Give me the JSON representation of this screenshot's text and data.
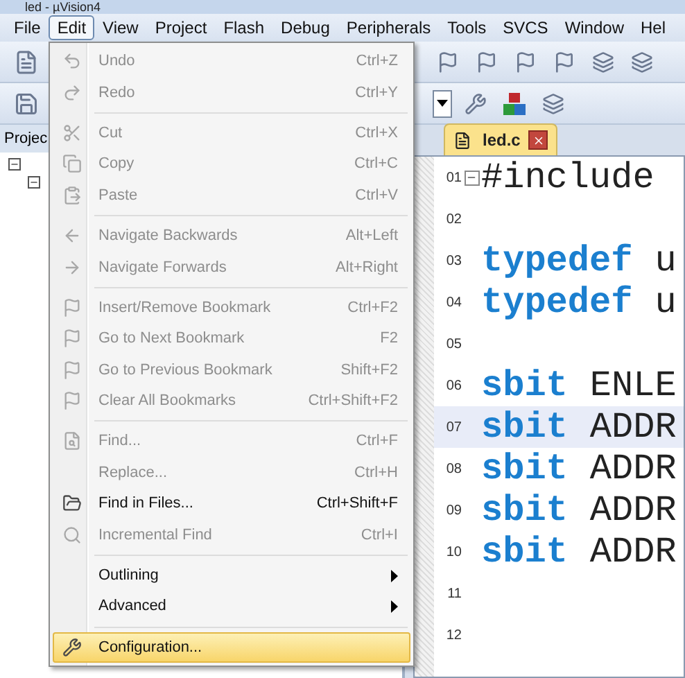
{
  "window": {
    "title": "led - µVision4"
  },
  "menubar": [
    {
      "label": "File",
      "selected": false
    },
    {
      "label": "Edit",
      "selected": true
    },
    {
      "label": "View",
      "selected": false
    },
    {
      "label": "Project",
      "selected": false
    },
    {
      "label": "Flash",
      "selected": false
    },
    {
      "label": "Debug",
      "selected": false
    },
    {
      "label": "Peripherals",
      "selected": false
    },
    {
      "label": "Tools",
      "selected": false
    },
    {
      "label": "SVCS",
      "selected": false
    },
    {
      "label": "Window",
      "selected": false
    },
    {
      "label": "Hel",
      "selected": false
    }
  ],
  "edit_menu": [
    {
      "kind": "item",
      "label": "Undo",
      "shortcut": "Ctrl+Z",
      "disabled": true,
      "selected": false
    },
    {
      "kind": "item",
      "label": "Redo",
      "shortcut": "Ctrl+Y",
      "disabled": true,
      "selected": false
    },
    {
      "kind": "separator"
    },
    {
      "kind": "item",
      "label": "Cut",
      "shortcut": "Ctrl+X",
      "disabled": true,
      "selected": false
    },
    {
      "kind": "item",
      "label": "Copy",
      "shortcut": "Ctrl+C",
      "disabled": true,
      "selected": false
    },
    {
      "kind": "item",
      "label": "Paste",
      "shortcut": "Ctrl+V",
      "disabled": true,
      "selected": false
    },
    {
      "kind": "separator"
    },
    {
      "kind": "item",
      "label": "Navigate Backwards",
      "shortcut": "Alt+Left",
      "disabled": true,
      "selected": false
    },
    {
      "kind": "item",
      "label": "Navigate Forwards",
      "shortcut": "Alt+Right",
      "disabled": true,
      "selected": false
    },
    {
      "kind": "separator"
    },
    {
      "kind": "item",
      "label": "Insert/Remove Bookmark",
      "shortcut": "Ctrl+F2",
      "disabled": true,
      "selected": false
    },
    {
      "kind": "item",
      "label": "Go to Next Bookmark",
      "shortcut": "F2",
      "disabled": true,
      "selected": false
    },
    {
      "kind": "item",
      "label": "Go to Previous Bookmark",
      "shortcut": "Shift+F2",
      "disabled": true,
      "selected": false
    },
    {
      "kind": "item",
      "label": "Clear All Bookmarks",
      "shortcut": "Ctrl+Shift+F2",
      "disabled": true,
      "selected": false
    },
    {
      "kind": "separator"
    },
    {
      "kind": "item",
      "label": "Find...",
      "shortcut": "Ctrl+F",
      "disabled": true,
      "selected": false
    },
    {
      "kind": "item",
      "label": "Replace...",
      "shortcut": "Ctrl+H",
      "disabled": true,
      "selected": false
    },
    {
      "kind": "item",
      "label": "Find in Files...",
      "shortcut": "Ctrl+Shift+F",
      "disabled": false,
      "selected": false
    },
    {
      "kind": "item",
      "label": "Incremental Find",
      "shortcut": "Ctrl+I",
      "disabled": true,
      "selected": false
    },
    {
      "kind": "separator"
    },
    {
      "kind": "submenu",
      "label": "Outlining",
      "disabled": false,
      "selected": false
    },
    {
      "kind": "submenu",
      "label": "Advanced",
      "disabled": false,
      "selected": false
    },
    {
      "kind": "separator"
    },
    {
      "kind": "item",
      "label": "Configuration...",
      "disabled": false,
      "selected": true
    }
  ],
  "project_panel": {
    "title": "Projec"
  },
  "editor": {
    "tab": {
      "label": "led.c"
    },
    "lines": [
      {
        "number": "01",
        "code": "#include",
        "foldable": true,
        "current": false
      },
      {
        "number": "02",
        "foldable": false,
        "current": false
      },
      {
        "number": "03",
        "keyword": "typedef",
        "code": "u",
        "foldable": false,
        "current": false
      },
      {
        "number": "04",
        "keyword": "typedef",
        "code": "u",
        "foldable": false,
        "current": false
      },
      {
        "number": "05",
        "foldable": false,
        "current": false
      },
      {
        "number": "06",
        "keyword": "sbit",
        "code": "ENLE",
        "foldable": false,
        "current": false
      },
      {
        "number": "07",
        "keyword": "sbit",
        "code": "ADDR",
        "foldable": false,
        "current": true
      },
      {
        "number": "08",
        "keyword": "sbit",
        "code": "ADDR",
        "foldable": false,
        "current": false
      },
      {
        "number": "09",
        "keyword": "sbit",
        "code": "ADDR",
        "foldable": false,
        "current": false
      },
      {
        "number": "10",
        "keyword": "sbit",
        "code": "ADDR",
        "foldable": false,
        "current": false
      },
      {
        "number": "11",
        "foldable": false,
        "current": false
      },
      {
        "number": "12",
        "foldable": false,
        "current": false
      }
    ]
  }
}
